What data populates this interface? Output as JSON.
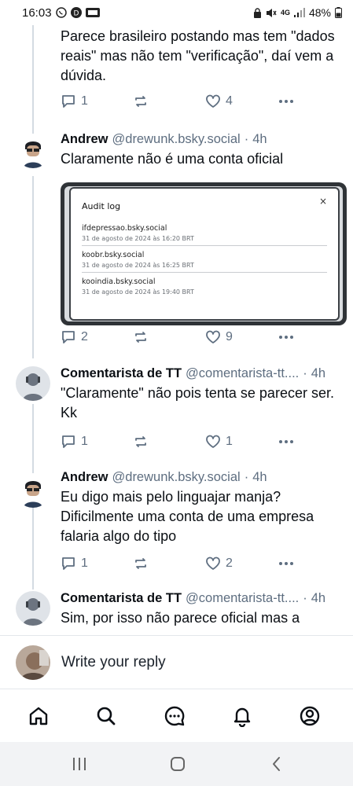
{
  "status_bar": {
    "time": "16:03",
    "network": "4G",
    "battery": "48%"
  },
  "feed": {
    "top_text": "Parece brasileiro postando mas tem \"dados reais\" mas não tem \"verificação\", daí vem a dúvida.",
    "top_counts": {
      "replies": "1",
      "likes": "4"
    },
    "posts": [
      {
        "author": "Andrew",
        "handle": "@drewunk.bsky.social",
        "time": "4h",
        "text": "Claramente não é uma conta oficial",
        "counts": {
          "replies": "2",
          "likes": "9"
        },
        "embed": {
          "title": "Audit log",
          "close": "×",
          "entries": [
            {
              "name": "ifdepressao.bsky.social",
              "date": "31 de agosto de 2024 às 16:20 BRT"
            },
            {
              "name": "koobr.bsky.social",
              "date": "31 de agosto de 2024 às 16:25 BRT"
            },
            {
              "name": "kooindia.bsky.social",
              "date": "31 de agosto de 2024 às 19:40 BRT"
            }
          ]
        }
      },
      {
        "author": "Comentarista de TT",
        "handle": "@comentarista-tt....",
        "time": "4h",
        "text": "\"Claramente\" não pois tenta se parecer ser. Kk",
        "counts": {
          "replies": "1",
          "likes": "1"
        }
      },
      {
        "author": "Andrew",
        "handle": "@drewunk.bsky.social",
        "time": "4h",
        "text": "Eu digo mais pelo linguajar manja? Dificilmente uma conta de uma empresa falaria algo do tipo",
        "counts": {
          "replies": "1",
          "likes": "2"
        }
      },
      {
        "author": "Comentarista de TT",
        "handle": "@comentarista-tt....",
        "time": "4h",
        "text": "Sim, por isso não parece oficial mas a"
      }
    ]
  },
  "reply_bar": {
    "placeholder": "Write your reply"
  },
  "bottom_nav": [
    "home-icon",
    "search-icon",
    "chat-icon",
    "bell-icon",
    "profile-icon"
  ],
  "colors": {
    "muted": "#5e6e80",
    "thread": "#d4dbe2",
    "text": "#0b0f14"
  }
}
